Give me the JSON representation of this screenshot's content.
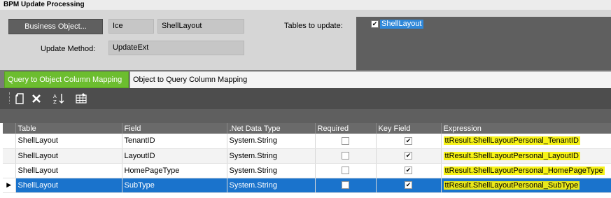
{
  "window": {
    "title": "BPM Update Processing"
  },
  "header": {
    "business_object_button": "Business Object...",
    "business_object_value": "Ice",
    "business_object_name": "ShellLayout",
    "update_method_label": "Update Method:",
    "update_method_value": "UpdateExt",
    "tables_to_update_label": "Tables to update:",
    "tables": [
      {
        "label": "ShellLayout",
        "checked": true
      }
    ]
  },
  "tabs": [
    {
      "label": "Query to Object Column Mapping",
      "active": true
    },
    {
      "label": "Object to Query Column Mapping",
      "active": false
    }
  ],
  "toolbar": {
    "icons": [
      "new-icon",
      "delete-icon",
      "sort-az-icon",
      "grid-settings-icon"
    ]
  },
  "grid": {
    "columns": [
      "Table",
      "Field",
      ".Net Data Type",
      "Required",
      "Key Field",
      "Expression"
    ],
    "rows": [
      {
        "table": "ShellLayout",
        "field": "TenantID",
        "type": "System.String",
        "required": false,
        "key": true,
        "expression": "ttResult.ShellLayoutPersonal_TenantID",
        "selected": false
      },
      {
        "table": "ShellLayout",
        "field": "LayoutID",
        "type": "System.String",
        "required": false,
        "key": true,
        "expression": "ttResult.ShellLayoutPersonal_LayoutID",
        "selected": false
      },
      {
        "table": "ShellLayout",
        "field": "HomePageType",
        "type": "System.String",
        "required": false,
        "key": true,
        "expression": "ttResult.ShellLayoutPersonal_HomePageType",
        "selected": false
      },
      {
        "table": "ShellLayout",
        "field": "SubType",
        "type": "System.String",
        "required": false,
        "key": true,
        "expression": "ttResult.ShellLayoutPersonal_SubType",
        "selected": true
      }
    ]
  },
  "colors": {
    "active_tab": "#6cbd2f",
    "selection": "#1a73cc",
    "highlight": "#f6f216"
  }
}
